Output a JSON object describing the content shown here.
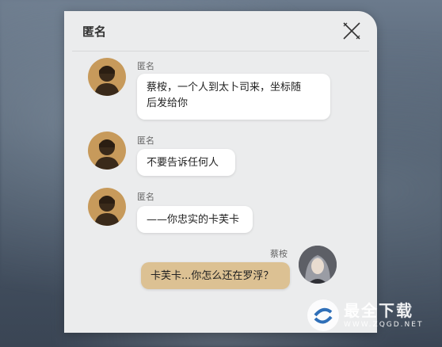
{
  "dialog": {
    "title": "匿名",
    "close_icon": "close-x-icon"
  },
  "messages": [
    {
      "sender": "匿名",
      "text_line1": "蔡桉，一个人到太卜司来，坐标随",
      "text_line2": "后发给你",
      "side": "left"
    },
    {
      "sender": "匿名",
      "text": "不要告诉任何人",
      "side": "left"
    },
    {
      "sender": "匿名",
      "text": "——你忠实的卡芙卡",
      "side": "left"
    },
    {
      "sender": "蔡桉",
      "text": "卡芙卡...你怎么还在罗浮？",
      "side": "right"
    }
  ],
  "watermark": {
    "main": "最全下载",
    "sub": "WWW.ZQGD.NET"
  },
  "colors": {
    "panel_bg": "#ebeced",
    "bubble_left": "#ffffff",
    "bubble_self": "#dcc193",
    "avatar_anon": "#c79a5b"
  }
}
